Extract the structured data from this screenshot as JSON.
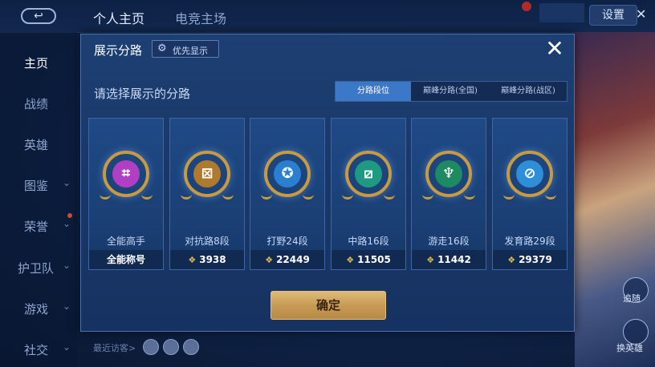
{
  "topbar": {
    "back_label": "↩",
    "tabs": [
      "个人主页",
      "电竞主场"
    ],
    "settings_label": "设置",
    "close_label": "✕"
  },
  "sidebar": {
    "items": [
      {
        "label": "主页",
        "chevron": ""
      },
      {
        "label": "战绩",
        "chevron": ""
      },
      {
        "label": "英雄",
        "chevron": ""
      },
      {
        "label": "图鉴",
        "chevron": "⌄"
      },
      {
        "label": "荣誉",
        "chevron": "⌄"
      },
      {
        "label": "护卫队",
        "chevron": "⌄"
      },
      {
        "label": "游戏",
        "chevron": "⌄"
      },
      {
        "label": "社交",
        "chevron": "⌄"
      }
    ]
  },
  "visitors": {
    "label": "最近访客>"
  },
  "right_panel": {
    "labels": [
      "追随",
      "换英雄"
    ]
  },
  "dialog": {
    "title": "展示分路",
    "priority_label": "优先显示",
    "close_label": "✕",
    "subtitle": "请选择展示的分路",
    "tabs": [
      {
        "label": "分路段位",
        "active": true
      },
      {
        "label": "巅峰分路(全国)",
        "active": false
      },
      {
        "label": "巅峰分路(战区)",
        "active": false
      }
    ],
    "cards": [
      {
        "name": "全能高手",
        "value": "全能称号",
        "icon": "all-round-emblem-icon",
        "color": "#b13fc4",
        "glyph": "⌗"
      },
      {
        "name": "对抗路8段",
        "value": "3938",
        "icon": "clash-lane-emblem-icon",
        "color": "#b07a2e",
        "glyph": "⊠"
      },
      {
        "name": "打野24段",
        "value": "22449",
        "icon": "jungle-emblem-icon",
        "color": "#2b7fd0",
        "glyph": "✪"
      },
      {
        "name": "中路16段",
        "value": "11505",
        "icon": "mid-lane-emblem-icon",
        "color": "#1e9a83",
        "glyph": "⧄"
      },
      {
        "name": "游走16段",
        "value": "11442",
        "icon": "roam-emblem-icon",
        "color": "#1d8a62",
        "glyph": "♆"
      },
      {
        "name": "发育路29段",
        "value": "29379",
        "icon": "farm-lane-emblem-icon",
        "color": "#2f8ed8",
        "glyph": "⊘"
      }
    ],
    "confirm_label": "确定"
  }
}
